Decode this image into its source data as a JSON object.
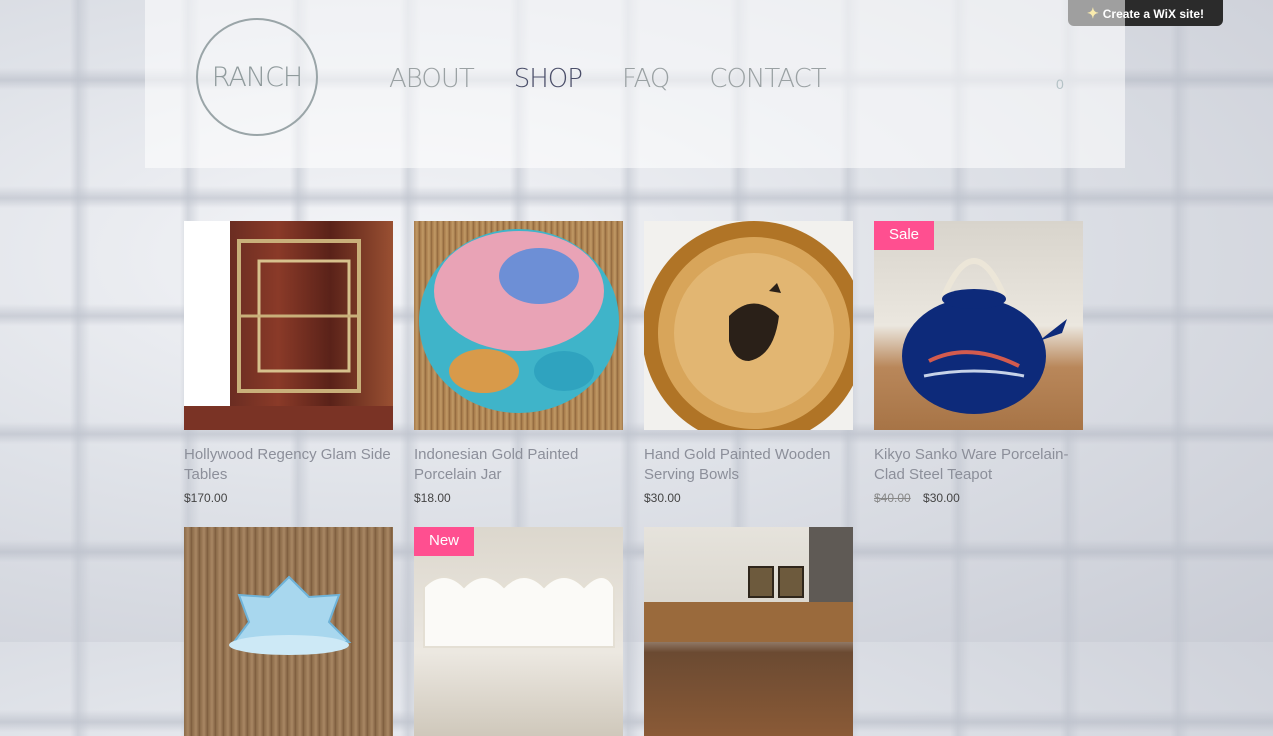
{
  "wix_banner": {
    "label": "Create a WiX site!",
    "icon": "wix-star-icon"
  },
  "logo": {
    "text": "RANCH"
  },
  "nav": {
    "items": [
      {
        "label": "ABOUT"
      },
      {
        "label": "SHOP"
      },
      {
        "label": "FAQ"
      },
      {
        "label": "CONTACT"
      }
    ],
    "active": "SHOP"
  },
  "cart": {
    "count": "0"
  },
  "products": [
    {
      "name": "Hollywood Regency Glam Side Tables",
      "price": "$170.00",
      "old_price": "",
      "badge": ""
    },
    {
      "name": "Indonesian Gold Painted Porcelain Jar",
      "price": "$18.00",
      "old_price": "",
      "badge": ""
    },
    {
      "name": "Hand Gold Painted Wooden Serving Bowls",
      "price": "$30.00",
      "old_price": "",
      "badge": ""
    },
    {
      "name": "Kikyo Sanko Ware Porcelain-Clad Steel Teapot",
      "price": "$30.00",
      "old_price": "$40.00",
      "badge": "Sale"
    },
    {
      "name": "",
      "price": "",
      "old_price": "",
      "badge": ""
    },
    {
      "name": "",
      "price": "",
      "old_price": "",
      "badge": "New"
    },
    {
      "name": "",
      "price": "",
      "old_price": "",
      "badge": ""
    }
  ],
  "colors": {
    "badge": "#ff4f90",
    "nav_active": "#4a4e69",
    "nav": "#9aa1a3",
    "text": "#8c8f9a"
  }
}
